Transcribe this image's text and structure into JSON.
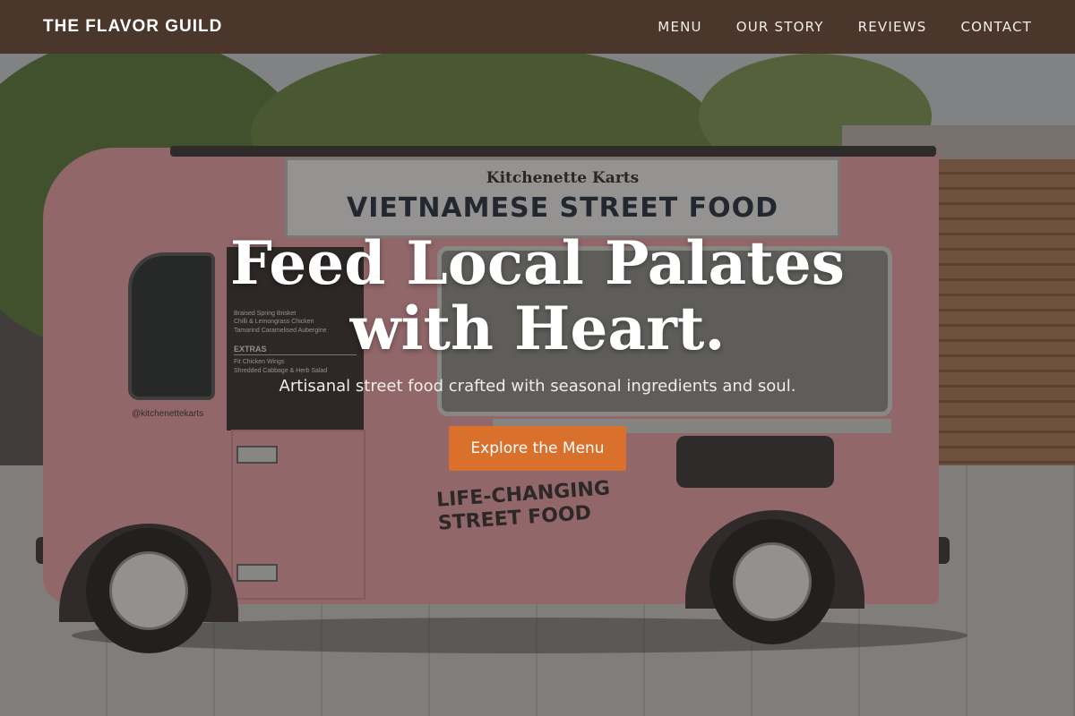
{
  "nav": {
    "brand": "THE FLAVOR GUILD",
    "links": [
      "MENU",
      "OUR STORY",
      "REVIEWS",
      "CONTACT"
    ]
  },
  "hero": {
    "headline": "Feed Local Palates with Heart.",
    "subheadline": "Artisanal street food crafted with seasonal ingredients and soul.",
    "cta_label": "Explore the Menu"
  },
  "photo": {
    "sign_brand": "Kitchenette Karts",
    "sign_title": "VIETNAMESE STREET FOOD",
    "menu_items": [
      "Braised Spring Brisket",
      "Chilli & Lemongrass Chicken",
      "Tamarind Caramelised Aubergine"
    ],
    "menu_extras_heading": "EXTRAS",
    "menu_extras": [
      "Fit Chicken Wings",
      "Shredded Cabbage & Herb Salad"
    ],
    "side_text_line1": "LIFE-CHANGING",
    "side_text_line2": "STREET FOOD",
    "handle": "@kitchenettekarts"
  },
  "colors": {
    "nav_bg": "#4a362b",
    "cta_bg": "#d9702b",
    "truck": "#e5a0a6"
  }
}
